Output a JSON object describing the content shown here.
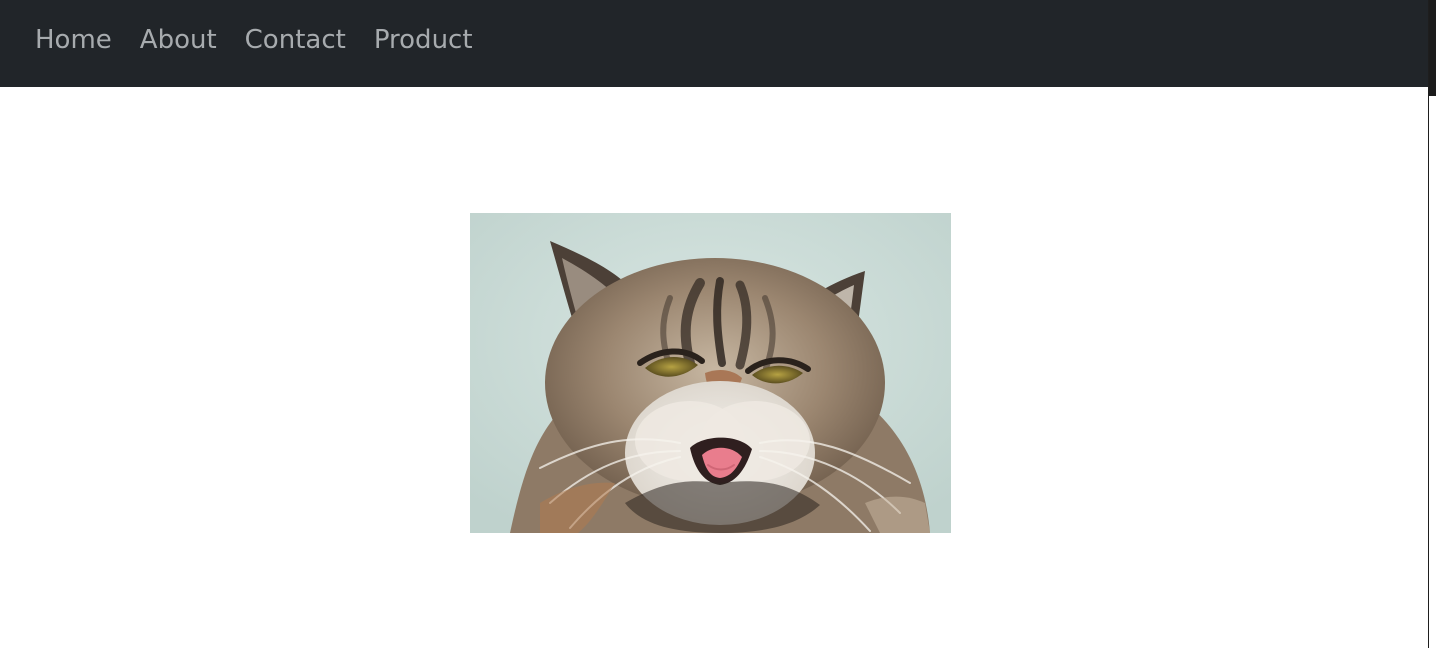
{
  "navbar": {
    "items": [
      {
        "label": "Home"
      },
      {
        "label": "About"
      },
      {
        "label": "Contact"
      },
      {
        "label": "Product"
      }
    ]
  },
  "main": {
    "image": {
      "subject": "cat"
    }
  },
  "colors": {
    "navbar_bg": "#212529",
    "nav_link": "#a7abae",
    "page_bg": "#ffffff"
  }
}
